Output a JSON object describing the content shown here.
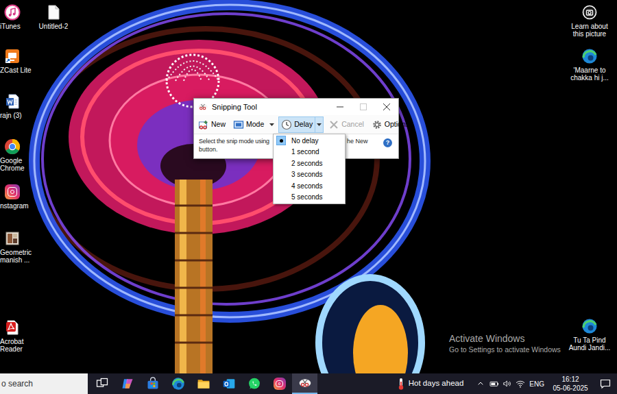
{
  "desktop": {
    "left_icons": [
      {
        "label": "iTunes",
        "kind": "itunes"
      },
      {
        "label": "ZCast Lite",
        "kind": "zcast"
      },
      {
        "label": "rajn (3)",
        "kind": "word-doc"
      },
      {
        "label": "Google Chrome",
        "kind": "chrome"
      },
      {
        "label": "nstagram",
        "kind": "instagram"
      },
      {
        "label": "Geometric manish ...",
        "kind": "image-file"
      },
      {
        "label": "Acrobat Reader",
        "kind": "acrobat"
      }
    ],
    "second_column": [
      {
        "label": "Untitled-2",
        "kind": "text-file"
      }
    ],
    "right_icons": [
      {
        "label": "Learn about this picture",
        "kind": "bing-info"
      },
      {
        "label": "'Maarne to chakka hi j...",
        "kind": "edge-shortcut"
      },
      {
        "label": "Tu Ta Pind Aundi Jandi...",
        "kind": "edge-shortcut"
      }
    ]
  },
  "watermark": {
    "title": "Activate Windows",
    "subtitle": "Go to Settings to activate Windows"
  },
  "snipping_tool": {
    "title": "Snipping Tool",
    "window_controls": [
      {
        "kind": "minimize",
        "disabled": false
      },
      {
        "kind": "maximize",
        "disabled": true
      },
      {
        "kind": "close",
        "disabled": false
      }
    ],
    "toolbar": [
      {
        "label": "New",
        "kind": "new",
        "has_menu": false,
        "disabled": false,
        "pressed": false
      },
      {
        "label": "Mode",
        "kind": "mode",
        "has_menu": true,
        "disabled": false,
        "pressed": false
      },
      {
        "label": "Delay",
        "kind": "delay",
        "has_menu": true,
        "disabled": false,
        "pressed": true
      },
      {
        "label": "Cancel",
        "kind": "cancel",
        "has_menu": false,
        "disabled": true,
        "pressed": false
      },
      {
        "label": "Options",
        "kind": "options",
        "has_menu": false,
        "disabled": false,
        "pressed": false
      }
    ],
    "hint": {
      "line1_left": "Select the snip mode using",
      "line1_right": "he New",
      "line2": "button."
    },
    "help": "?"
  },
  "delay_menu": [
    {
      "label": "No delay",
      "selected": true
    },
    {
      "label": "1 second",
      "selected": false
    },
    {
      "label": "2 seconds",
      "selected": false
    },
    {
      "label": "3 seconds",
      "selected": false
    },
    {
      "label": "4 seconds",
      "selected": false
    },
    {
      "label": "5 seconds",
      "selected": false
    }
  ],
  "taskbar": {
    "search": "o search",
    "apps": [
      {
        "kind": "task-view",
        "active": false
      },
      {
        "kind": "copilot",
        "active": false
      },
      {
        "kind": "store",
        "active": false
      },
      {
        "kind": "edge",
        "active": false
      },
      {
        "kind": "file-explorer",
        "active": false
      },
      {
        "kind": "outlook",
        "active": false
      },
      {
        "kind": "whatsapp",
        "active": false
      },
      {
        "kind": "instagram",
        "active": false
      },
      {
        "kind": "snipping-tool",
        "active": true
      }
    ],
    "weather": "Hot days ahead",
    "tray": [
      {
        "kind": "chevron"
      },
      {
        "kind": "battery"
      },
      {
        "kind": "volume"
      },
      {
        "kind": "network"
      }
    ],
    "language": "ENG",
    "time": "16:12",
    "date": "05-06-2025"
  }
}
